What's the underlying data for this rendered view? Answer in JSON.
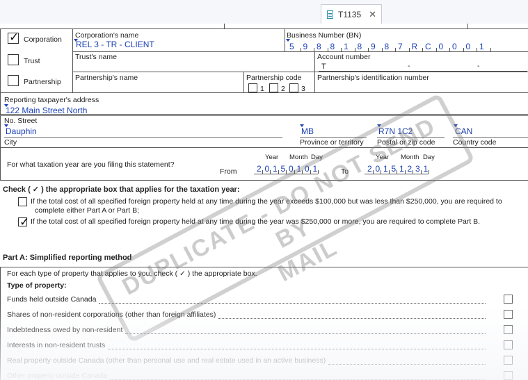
{
  "tab": {
    "title": "T1135",
    "close": "✕"
  },
  "entity": {
    "corporation": {
      "label": "Corporation",
      "checked": true
    },
    "trust": {
      "label": "Trust"
    },
    "partnership": {
      "label": "Partnership"
    }
  },
  "fields": {
    "corp_name_label": "Corporation's name",
    "corp_name_value": "REL 3 - TR - CLIENT",
    "bn_label": "Business Number (BN)",
    "bn_digits": [
      "5",
      "9",
      "8",
      "8",
      "1",
      "8",
      "9",
      "8",
      "7",
      "R",
      "C",
      "0",
      "0",
      "0",
      "1"
    ],
    "trust_name_label": "Trust's name",
    "account_label": "Account number",
    "account_prefix": "T",
    "partnership_name_label": "Partnership's name",
    "partnership_code_label": "Partnership code",
    "partnership_codes": [
      "1",
      "2",
      "3"
    ],
    "partnership_id_label": "Partnership's identification number",
    "address_label": "Reporting taxpayer's address",
    "street_value": "122 Main Street North",
    "street_label": "No. Street",
    "city_value": "Dauphin",
    "city_label": "City",
    "province_value": "MB",
    "province_label": "Province or territory",
    "postal_value": "R7N 1C2",
    "postal_label": "Postal or zip code",
    "country_value": "CAN",
    "country_label": "Country code"
  },
  "taxyear": {
    "question": "For what taxation year are you filing this statement?",
    "from_label": "From",
    "to_label": "To",
    "year_label": "Year",
    "month_label": "Month",
    "day_label": "Day",
    "from_digits": [
      "2",
      "0",
      "1",
      "5",
      "0",
      "1",
      "0",
      "1"
    ],
    "to_digits": [
      "2",
      "0",
      "1",
      "5",
      "1",
      "2",
      "3",
      "1"
    ]
  },
  "check_section": {
    "heading": "Check ( ✓ ) the appropriate box that applies for the taxation year:",
    "option1_line1": "If the total cost of all specified foreign property held at any time during the year exceeds $100,000 but was less than $250,000, you are required to",
    "option1_line2": "complete either Part A or Part B;",
    "option2": "If the total cost of all specified foreign property held at any time during the year was $250,000 or more, you are required to complete Part B.",
    "option2_checked": true
  },
  "partA": {
    "title": "Part A: Simplified reporting method",
    "instruction": "For each type of property that applies to you, check ( ✓ ) the appropriate box.",
    "type_heading": "Type of property:",
    "items": [
      "Funds held outside Canada",
      "Shares of non-resident corporations (other than foreign affiliates)",
      "Indebtedness owed by non-resident",
      "Interests in non-resident trusts",
      "Real property outside Canada (other than personal use and real estate used in an active business)",
      "Other property outside Canada"
    ]
  },
  "stamp": {
    "line1": "DUPLICATE - DO NOT SEND BY",
    "line2": "MAIL"
  }
}
